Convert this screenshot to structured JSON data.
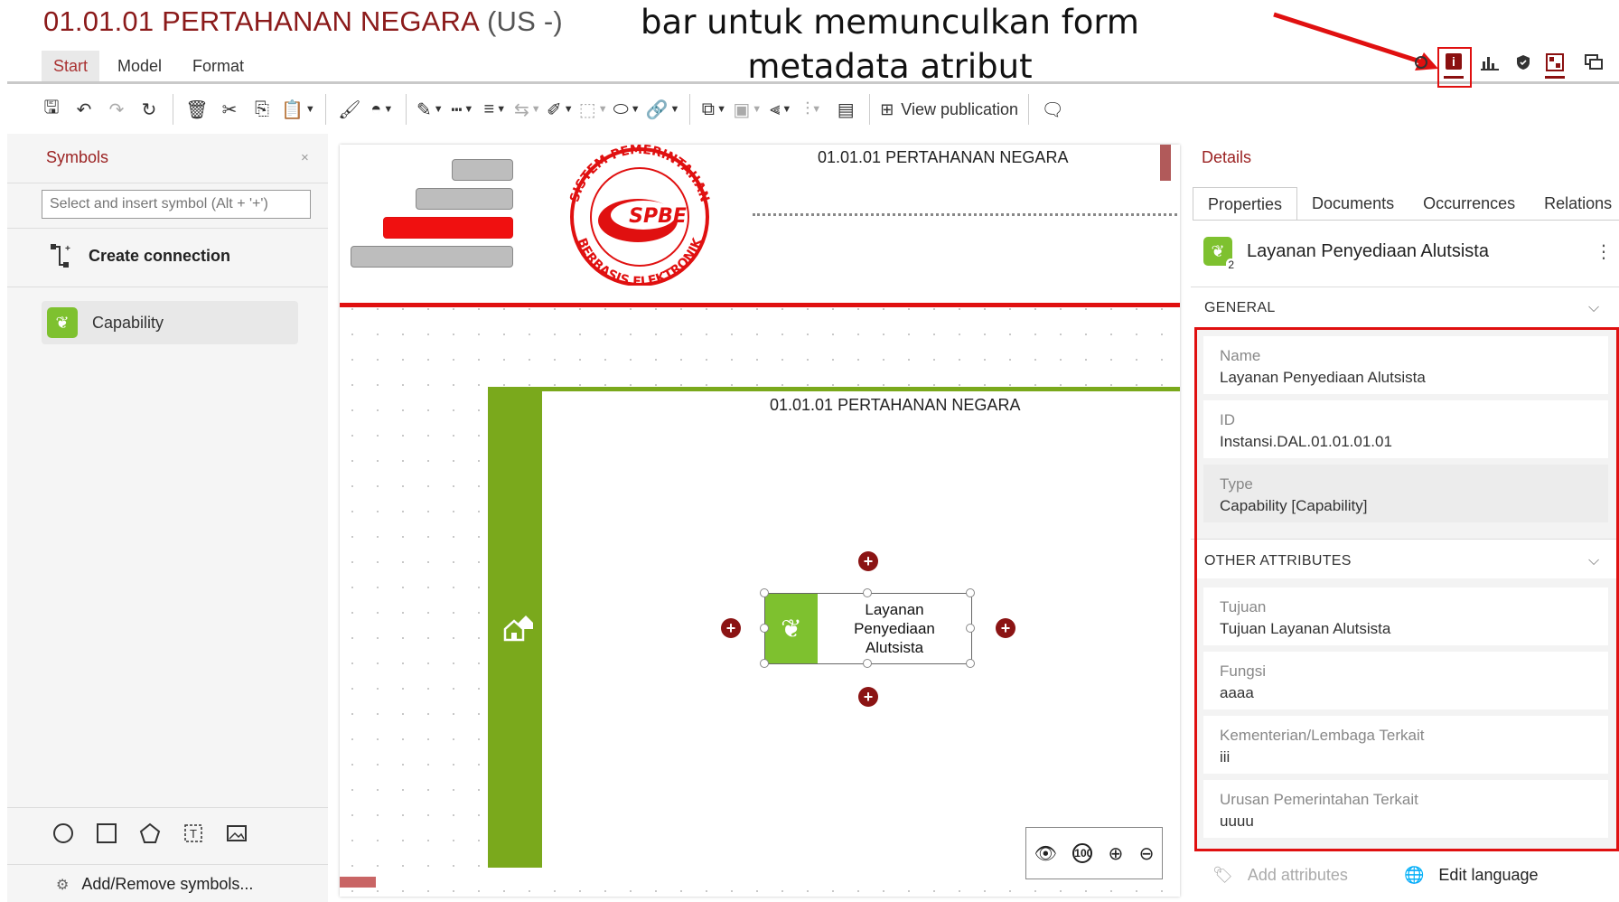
{
  "header": {
    "doc_title": "01.01.01 PERTAHANAN NEGARA",
    "lang": "(US -)",
    "annotation_line1": "bar untuk memunculkan form",
    "annotation_line2": "metadata atribut"
  },
  "ribbon_tabs": [
    {
      "label": "Start",
      "active": true
    },
    {
      "label": "Model",
      "active": false
    },
    {
      "label": "Format",
      "active": false
    }
  ],
  "toolbar": {
    "view_publication": "View publication"
  },
  "top_right_icons": [
    "pin-icon",
    "info-icon",
    "bar-chart-icon",
    "shield-icon",
    "layout-icon",
    "chat-icon"
  ],
  "symbols_panel": {
    "title": "Symbols",
    "close": "×",
    "search_placeholder": "Select and insert symbol (Alt + '+')",
    "create_connection": "Create connection",
    "items": [
      {
        "label": "Capability"
      }
    ],
    "add_remove": "Add/Remove symbols..."
  },
  "canvas": {
    "header_title": "01.01.01 PERTAHANAN NEGARA",
    "logo_text_top": "SISTEM PEMERINTAHAN",
    "logo_text_center": "SPBE",
    "logo_text_bottom": "BERBASIS ELEKTRONIK",
    "lane_title": "01.01.01 PERTAHANAN NEGARA",
    "node_line1": "Layanan",
    "node_line2": "Penyediaan",
    "node_line3": "Alutsista"
  },
  "details_panel": {
    "title": "Details",
    "close": "×",
    "tabs": [
      {
        "label": "Properties",
        "active": true
      },
      {
        "label": "Documents",
        "active": false
      },
      {
        "label": "Occurrences",
        "active": false
      },
      {
        "label": "Relations",
        "active": false
      }
    ],
    "object_name": "Layanan Penyediaan Alutsista",
    "object_badge": "2",
    "general_heading": "GENERAL",
    "general_fields": [
      {
        "label": "Name",
        "value": "Layanan Penyediaan Alutsista"
      },
      {
        "label": "ID",
        "value": "Instansi.DAL.01.01.01.01"
      },
      {
        "label": "Type",
        "value": "Capability [Capability]"
      }
    ],
    "other_heading": "OTHER ATTRIBUTES",
    "other_fields": [
      {
        "label": "Tujuan",
        "value": "Tujuan Layanan Alutsista"
      },
      {
        "label": "Fungsi",
        "value": "aaaa"
      },
      {
        "label": "Kementerian/Lembaga Terkait",
        "value": "iii"
      },
      {
        "label": "Urusan Pemerintahan Terkait",
        "value": "uuuu"
      }
    ],
    "add_attributes": "Add attributes",
    "edit_language": "Edit language"
  },
  "colors": {
    "brand": "#8b1a1a",
    "highlight": "#e01010",
    "capability_green": "#7ec12f",
    "lane_green": "#7aa91c"
  }
}
